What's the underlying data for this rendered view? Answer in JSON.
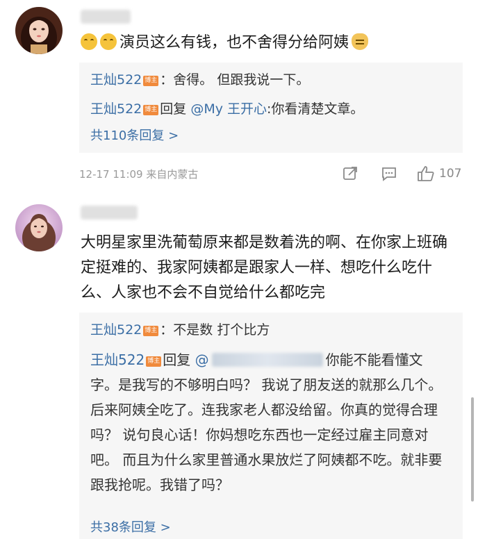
{
  "comment1": {
    "text": "演员这么有钱，也不舍得分给阿姨",
    "avatar_icon": "woman-portrait-avatar",
    "replies": [
      {
        "name": "王灿522",
        "badge": "博主",
        "sep": "：",
        "text": "舍得。 但跟我说一下。"
      },
      {
        "name": "王灿522",
        "badge": "博主",
        "prefix": "回复",
        "mention": "@My 王开心",
        "text": ":你看清楚文章。"
      }
    ],
    "more": "共110条回复 >",
    "timestamp": "12-17 11:09",
    "location": "来自内蒙古",
    "likes": "107"
  },
  "comment2": {
    "text": "大明星家里洗葡萄原来都是数着洗的啊、在你家上班确定挺难的、我家阿姨都是跟家人一样、想吃什么吃什么、人家也不会不自觉给什么都吃完",
    "avatar_icon": "woman-photo-avatar",
    "replies": [
      {
        "name": "王灿522",
        "badge": "博主",
        "sep": "：",
        "text": "不是数 打个比方"
      },
      {
        "name": "王灿522",
        "badge": "博主",
        "prefix": "回复",
        "mention": "@",
        "text": "你能不能看懂文字。是我写的不够明白吗？ 我说了朋友送的就那么几个。后来阿姨全吃了。连我家老人都没给留。你真的觉得合理吗？ 说句良心话！你妈想吃东西也一定经过雇主同意对吧。 而且为什么家里普通水果放烂了阿姨都不吃。就非要跟我抢呢。我错了吗？"
      }
    ],
    "more": "共38条回复 >"
  }
}
